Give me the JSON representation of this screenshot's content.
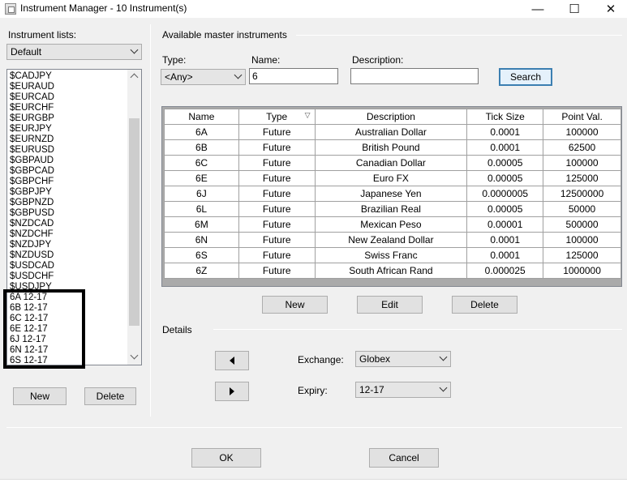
{
  "window": {
    "title": "Instrument Manager - 10 Instrument(s)",
    "minimize_glyph": "—",
    "maximize_glyph": "☐",
    "close_glyph": "✕"
  },
  "instrument_lists": {
    "label": "Instrument lists:",
    "selected": "Default",
    "items": [
      "$CADJPY",
      "$EURAUD",
      "$EURCAD",
      "$EURCHF",
      "$EURGBP",
      "$EURJPY",
      "$EURNZD",
      "$EURUSD",
      "$GBPAUD",
      "$GBPCAD",
      "$GBPCHF",
      "$GBPJPY",
      "$GBPNZD",
      "$GBPUSD",
      "$NZDCAD",
      "$NZDCHF",
      "$NZDJPY",
      "$NZDUSD",
      "$USDCAD",
      "$USDCHF",
      "$USDJPY",
      "6A 12-17",
      "6B 12-17",
      "6C 12-17",
      "6E 12-17",
      "6J 12-17",
      "6N 12-17",
      "6S 12-17"
    ],
    "new_label": "New",
    "delete_label": "Delete"
  },
  "master": {
    "group_label": "Available master instruments",
    "type_label": "Type:",
    "type_value": "<Any>",
    "name_label": "Name:",
    "name_value": "6",
    "description_label": "Description:",
    "description_value": "",
    "search_label": "Search",
    "columns": [
      "Name",
      "Type",
      "Description",
      "Tick Size",
      "Point Val."
    ],
    "sort_indicator": "▽",
    "rows": [
      [
        "6A",
        "Future",
        "Australian Dollar",
        "0.0001",
        "100000"
      ],
      [
        "6B",
        "Future",
        "British Pound",
        "0.0001",
        "62500"
      ],
      [
        "6C",
        "Future",
        "Canadian Dollar",
        "0.00005",
        "100000"
      ],
      [
        "6E",
        "Future",
        "Euro FX",
        "0.00005",
        "125000"
      ],
      [
        "6J",
        "Future",
        "Japanese Yen",
        "0.0000005",
        "12500000"
      ],
      [
        "6L",
        "Future",
        "Brazilian Real",
        "0.00005",
        "50000"
      ],
      [
        "6M",
        "Future",
        "Mexican Peso",
        "0.00001",
        "500000"
      ],
      [
        "6N",
        "Future",
        "New Zealand Dollar",
        "0.0001",
        "100000"
      ],
      [
        "6S",
        "Future",
        "Swiss Franc",
        "0.0001",
        "125000"
      ],
      [
        "6Z",
        "Future",
        "South African Rand",
        "0.000025",
        "1000000"
      ]
    ],
    "new_label": "New",
    "edit_label": "Edit",
    "delete_label": "Delete"
  },
  "details": {
    "group_label": "Details",
    "exchange_label": "Exchange:",
    "exchange_value": "Globex",
    "expiry_label": "Expiry:",
    "expiry_value": "12-17"
  },
  "footer": {
    "ok_label": "OK",
    "cancel_label": "Cancel"
  },
  "colors": {
    "window_bg": "#f0f0f0",
    "default_button_border": "#3c7fb1",
    "highlight_box": "#000000"
  }
}
